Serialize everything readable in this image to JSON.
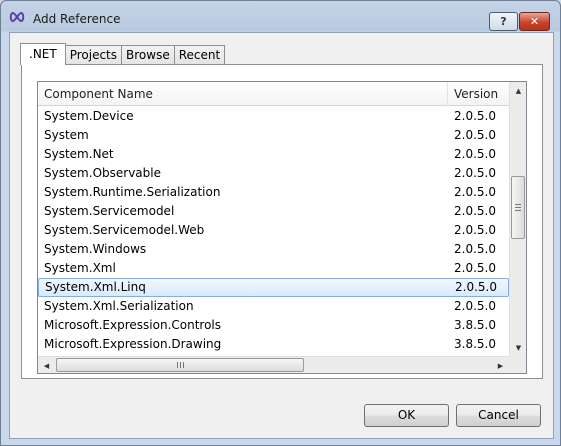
{
  "window": {
    "title": "Add Reference",
    "help_label": "?",
    "close_label": "✕"
  },
  "tabs": [
    {
      "label": ".NET",
      "active": true
    },
    {
      "label": "Projects",
      "active": false
    },
    {
      "label": "Browse",
      "active": false
    },
    {
      "label": "Recent",
      "active": false
    }
  ],
  "list": {
    "columns": {
      "name": "Component Name",
      "version": "Version"
    },
    "rows": [
      {
        "name": "System.Device",
        "version": "2.0.5.0",
        "selected": false
      },
      {
        "name": "System",
        "version": "2.0.5.0",
        "selected": false
      },
      {
        "name": "System.Net",
        "version": "2.0.5.0",
        "selected": false
      },
      {
        "name": "System.Observable",
        "version": "2.0.5.0",
        "selected": false
      },
      {
        "name": "System.Runtime.Serialization",
        "version": "2.0.5.0",
        "selected": false
      },
      {
        "name": "System.Servicemodel",
        "version": "2.0.5.0",
        "selected": false
      },
      {
        "name": "System.Servicemodel.Web",
        "version": "2.0.5.0",
        "selected": false
      },
      {
        "name": "System.Windows",
        "version": "2.0.5.0",
        "selected": false
      },
      {
        "name": "System.Xml",
        "version": "2.0.5.0",
        "selected": false
      },
      {
        "name": "System.Xml.Linq",
        "version": "2.0.5.0",
        "selected": true
      },
      {
        "name": "System.Xml.Serialization",
        "version": "2.0.5.0",
        "selected": false
      },
      {
        "name": "Microsoft.Expression.Controls",
        "version": "3.8.5.0",
        "selected": false
      },
      {
        "name": "Microsoft.Expression.Drawing",
        "version": "3.8.5.0",
        "selected": false
      }
    ]
  },
  "buttons": {
    "ok": "OK",
    "cancel": "Cancel"
  },
  "colors": {
    "selection_fill": "#d9eafc",
    "selection_border": "#84acdd",
    "title_bar": "#b9cbe2",
    "close_button": "#c7442a"
  }
}
